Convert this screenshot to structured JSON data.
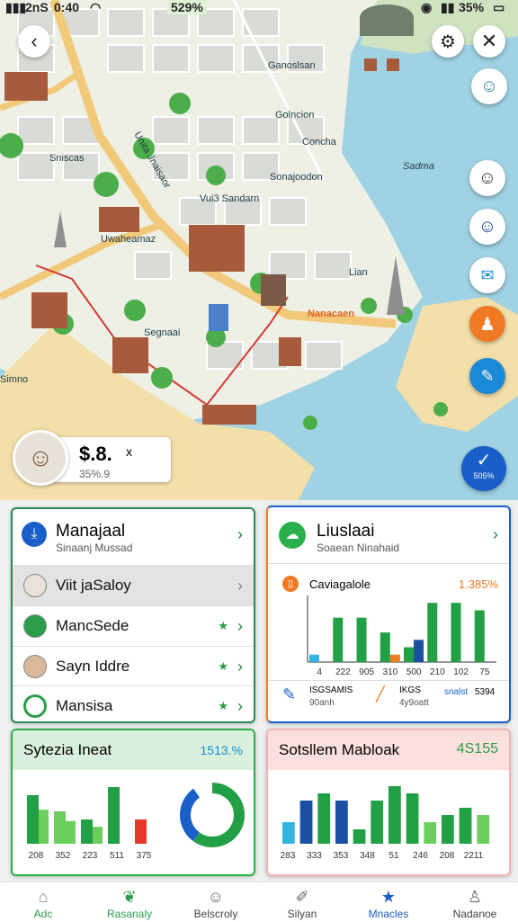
{
  "status": {
    "time": "0:40",
    "carrier": "2nS",
    "percent_badge": "529%",
    "battery": "35%"
  },
  "map": {
    "labels": [
      "Ganoslsan",
      "Golncion",
      "Concha",
      "Sadma",
      "Sonajoodon",
      "Nanacaen",
      "Lian",
      "Simno",
      "Uwaheamaz",
      "Segnaai",
      "Sniscas",
      "Unita Jnaisaor",
      "Vui3 Sandarn"
    ],
    "done_badge": "505%"
  },
  "user_chip": {
    "value": "$.8.",
    "sub": "35%.9",
    "close": "x"
  },
  "card_left": {
    "title": "Manajaal",
    "subtitle": "Sinaanj Mussad",
    "rows": [
      {
        "label": "Viit jaSaloy"
      },
      {
        "label": "MancSede"
      },
      {
        "label": "Sayn Iddre"
      },
      {
        "label": "Mansisa"
      }
    ]
  },
  "card_right": {
    "title": "Liuslaai",
    "subtitle": "Soaean Ninahaid",
    "chart_title": "Caviagalole",
    "chart_value": "1.385%",
    "footer_a": "ISGSAMIS",
    "footer_a2": "90anh",
    "footer_b": "IKGS",
    "footer_b2": "4y9oatt",
    "footer_c": "snalst",
    "footer_d": "5394"
  },
  "card_bottom_left": {
    "title": "Sytezia Ineat",
    "value": "1513.%"
  },
  "card_bottom_right": {
    "title": "Sotsllem Mabloak",
    "value": "4S155"
  },
  "chart_data": [
    {
      "type": "bar",
      "title": "Caviagalole",
      "categories": [
        "4",
        "222",
        "905",
        "310",
        "500",
        "210",
        "102",
        "75"
      ],
      "series": [
        {
          "values": [
            1,
            6,
            6,
            4,
            2,
            8,
            8,
            7
          ]
        },
        {
          "values": [
            0,
            0,
            0,
            1,
            3,
            0,
            0,
            0
          ]
        }
      ],
      "colors": [
        "#22a045",
        "#f07a23",
        "#1a4fa3",
        "#32b4e0"
      ],
      "ylim": [
        0,
        9
      ]
    },
    {
      "type": "bar",
      "categories": [
        "208",
        "352",
        "223",
        "511",
        "375"
      ],
      "values": [
        6,
        4,
        3,
        7,
        3
      ],
      "colors": [
        "#22a045",
        "#6ccf5d",
        "#22a045",
        "#22a045",
        "#e53a2a"
      ],
      "ylim": [
        0,
        8
      ]
    },
    {
      "type": "pie",
      "slices": [
        {
          "value": 60,
          "color": "#22a045"
        },
        {
          "value": 30,
          "color": "#1a5fc8"
        },
        {
          "value": 10,
          "color": "#ffffff"
        }
      ]
    },
    {
      "type": "bar",
      "categories": [
        "283",
        "333",
        "353",
        "348",
        "51",
        "246",
        "208",
        "2211"
      ],
      "values": [
        3,
        6,
        7,
        6,
        2,
        6,
        8,
        7,
        3,
        4,
        5,
        4
      ],
      "colors": [
        "#32b4e0",
        "#1a4fa3",
        "#22a045",
        "#1a4fa3",
        "#22a045",
        "#22a045",
        "#22a045",
        "#22a045",
        "#6ccf5d",
        "#22a045",
        "#22a045",
        "#6ccf5d"
      ],
      "ylim": [
        0,
        9
      ]
    }
  ],
  "nav": [
    {
      "label": "Adc",
      "icon": "home-icon"
    },
    {
      "label": "Rasanaly",
      "icon": "leaf-icon"
    },
    {
      "label": "Belscroly",
      "icon": "people-icon"
    },
    {
      "label": "Silyan",
      "icon": "edit-icon"
    },
    {
      "label": "Mnacles",
      "icon": "star-icon"
    },
    {
      "label": "Nadanoe",
      "icon": "person-icon"
    }
  ]
}
